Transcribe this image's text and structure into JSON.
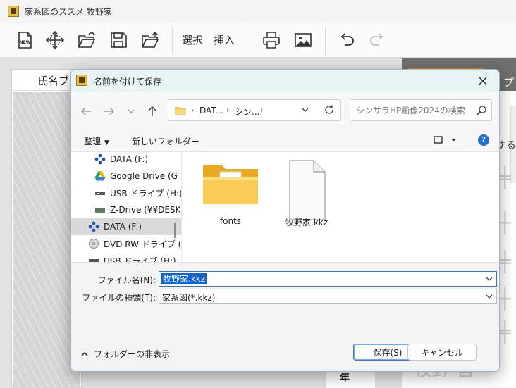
{
  "app": {
    "title": "家系図のススメ 牧野家",
    "toolbar": {
      "select_label": "選択",
      "insert_label": "挿入"
    },
    "name_panel_header": "氏名ブ",
    "right_panel": {
      "tab_label": "プ",
      "hint_text": "する",
      "bottom_text": "牧野 吾"
    },
    "bottom_stub_text": "年"
  },
  "dialog": {
    "title": "名前を付けて保存",
    "address": {
      "segments": [
        "DAT...",
        "シン..."
      ]
    },
    "search": {
      "placeholder": "シンサラHP画像2024の検索"
    },
    "commands": {
      "organize": "整理",
      "new_folder": "新しいフォルダー"
    },
    "nav_items": [
      {
        "label": "DATA (F:)",
        "icon": "network-drive-icon"
      },
      {
        "label": "Google Drive (G",
        "icon": "google-drive-icon"
      },
      {
        "label": "USB ドライブ (H:)",
        "icon": "usb-drive-icon"
      },
      {
        "label": "Z-Drive (¥¥DESK",
        "icon": "z-drive-icon"
      },
      {
        "label": "DATA (F:)",
        "icon": "network-drive-icon",
        "selected": true
      },
      {
        "label": "DVD RW ドライブ (D",
        "icon": "dvd-drive-icon"
      },
      {
        "label": "USB ドライブ (H:)",
        "icon": "usb-drive-icon"
      }
    ],
    "files": [
      {
        "name": "fonts",
        "type": "folder"
      },
      {
        "name": "牧野家.kkz",
        "type": "file"
      }
    ],
    "form": {
      "filename_label": "ファイル名(N):",
      "filename_value": "牧野家.kkz",
      "filetype_label": "ファイルの種類(T):",
      "filetype_value": "家系図(*.kkz)"
    },
    "hide_folders_label": "フォルダーの非表示",
    "save_label": "保存(S)",
    "cancel_label": "キャンセル"
  },
  "colors": {
    "accent": "#0a64d6",
    "title_bar": "#e8f4f5",
    "folder": "#f6c244",
    "orange_tab": "#d88a4a"
  }
}
